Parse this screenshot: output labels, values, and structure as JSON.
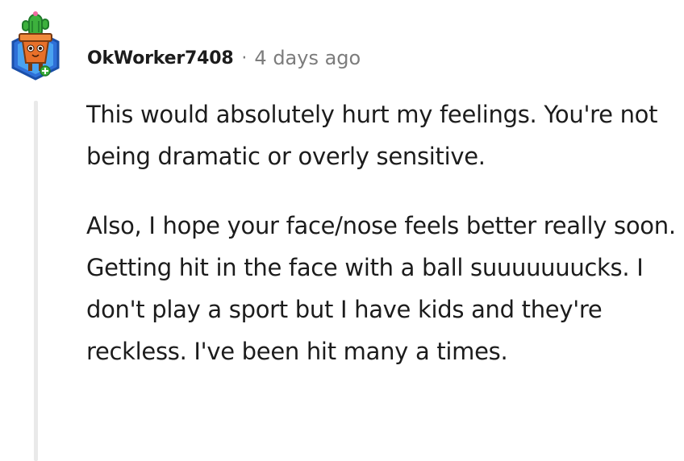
{
  "comment": {
    "author": "OkWorker7408",
    "separator": "·",
    "timestamp": "4 days ago",
    "avatar_icon": "cactus-pot-avatar-icon",
    "paragraphs": [
      "This would absolutely hurt my feelings. You're not being dramatic or overly sensitive.",
      "Also, I hope your face/nose feels better really soon. Getting hit in the face with a ball suuuuuuucks. I don't play a sport but I have kids and they're reckless. I've been hit many a times."
    ]
  },
  "colors": {
    "text": "#1c1c1c",
    "meta": "#7c7c7c",
    "thread_line": "#e9e9e9",
    "avatar_bg": "#2e6fd8",
    "pot": "#e8702a",
    "cactus": "#3db13d"
  }
}
